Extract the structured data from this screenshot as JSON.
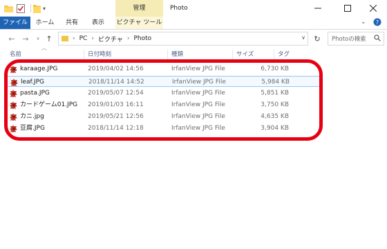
{
  "window": {
    "title": "Photo",
    "context_tab_label": "管理",
    "buttons": {
      "minimize": "—",
      "maximize": "☐",
      "close": "✕"
    }
  },
  "ribbon": {
    "tabs": [
      {
        "label": "ファイル"
      },
      {
        "label": "ホーム"
      },
      {
        "label": "共有"
      },
      {
        "label": "表示"
      },
      {
        "label": "ピクチャ ツール"
      }
    ]
  },
  "address": {
    "crumbs": [
      "PC",
      "ピクチャ",
      "Photo"
    ],
    "search_placeholder": "Photoの検索"
  },
  "columns": {
    "name": "名前",
    "date": "日付時刻",
    "type": "種類",
    "size": "サイズ",
    "tag": "タグ"
  },
  "files": [
    {
      "name": "karaage.JPG",
      "date": "2019/04/02 14:56",
      "type": "IrfanView JPG File",
      "size": "6,730 KB",
      "selected": false
    },
    {
      "name": "leaf.JPG",
      "date": "2018/11/14 14:52",
      "type": "IrfanView JPG File",
      "size": "5,984 KB",
      "selected": true
    },
    {
      "name": "pasta.JPG",
      "date": "2019/05/07 12:54",
      "type": "IrfanView JPG File",
      "size": "5,851 KB",
      "selected": false
    },
    {
      "name": "カードゲーム01.JPG",
      "date": "2019/01/03 16:11",
      "type": "IrfanView JPG File",
      "size": "3,750 KB",
      "selected": false
    },
    {
      "name": "カニ.jpg",
      "date": "2019/05/21 12:56",
      "type": "IrfanView JPG File",
      "size": "4,635 KB",
      "selected": false
    },
    {
      "name": "豆腐.JPG",
      "date": "2018/11/14 12:18",
      "type": "IrfanView JPG File",
      "size": "3,904 KB",
      "selected": false
    }
  ],
  "colors": {
    "file_tab": "#1f63b5",
    "manage_tab": "#f5ebb4",
    "highlight": "#e60012",
    "selection_border": "#99c8f0"
  },
  "icons": {
    "file": "irfanview-file-icon",
    "folder": "folder-icon"
  }
}
